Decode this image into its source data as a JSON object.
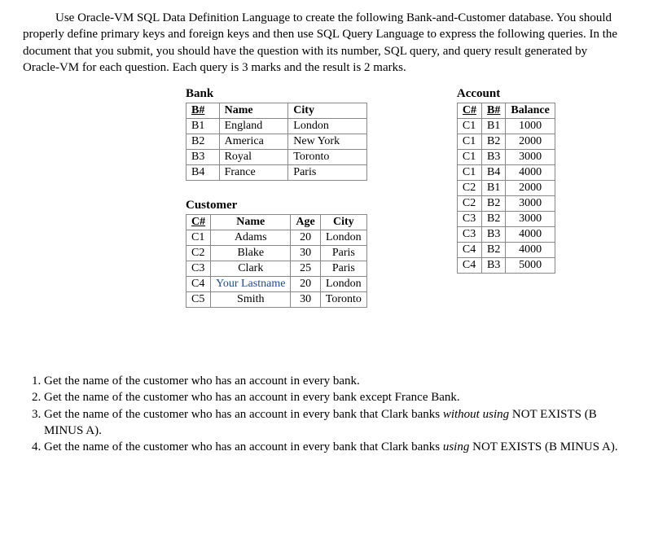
{
  "intro": {
    "text": "Use Oracle-VM SQL Data Definition Language to create the following Bank-and-Customer database. You should properly define primary keys and foreign keys and then use SQL Query Language to express the following queries. In the document that you submit, you should have the question with its number, SQL query, and query result generated by Oracle-VM for each question. Each query is 3 marks and the result is 2 marks."
  },
  "bank": {
    "title": "Bank",
    "headers": {
      "bnum": "B#",
      "name": "Name",
      "city": "City"
    },
    "rows": [
      {
        "bnum": "B1",
        "name": "England",
        "city": "London"
      },
      {
        "bnum": "B2",
        "name": "America",
        "city": "New York"
      },
      {
        "bnum": "B3",
        "name": "Royal",
        "city": "Toronto"
      },
      {
        "bnum": "B4",
        "name": "France",
        "city": "Paris"
      }
    ]
  },
  "customer": {
    "title": "Customer",
    "headers": {
      "cnum": "C#",
      "name": "Name",
      "age": "Age",
      "city": "City"
    },
    "rows": [
      {
        "cnum": "C1",
        "name": "Adams",
        "age": "20",
        "city": "London",
        "name_class": ""
      },
      {
        "cnum": "C2",
        "name": "Blake",
        "age": "30",
        "city": "Paris",
        "name_class": ""
      },
      {
        "cnum": "C3",
        "name": "Clark",
        "age": "25",
        "city": "Paris",
        "name_class": ""
      },
      {
        "cnum": "C4",
        "name": "Your Lastname",
        "age": "20",
        "city": "London",
        "name_class": "your-lastname"
      },
      {
        "cnum": "C5",
        "name": "Smith",
        "age": "30",
        "city": "Toronto",
        "name_class": ""
      }
    ]
  },
  "account": {
    "title": "Account",
    "headers": {
      "cnum": "C#",
      "bnum": "B#",
      "balance": "Balance"
    },
    "rows": [
      {
        "cnum": "C1",
        "bnum": "B1",
        "balance": "1000"
      },
      {
        "cnum": "C1",
        "bnum": "B2",
        "balance": "2000"
      },
      {
        "cnum": "C1",
        "bnum": "B3",
        "balance": "3000"
      },
      {
        "cnum": "C1",
        "bnum": "B4",
        "balance": "4000"
      },
      {
        "cnum": "C2",
        "bnum": "B1",
        "balance": "2000"
      },
      {
        "cnum": "C2",
        "bnum": "B2",
        "balance": "3000"
      },
      {
        "cnum": "C3",
        "bnum": "B2",
        "balance": "3000"
      },
      {
        "cnum": "C3",
        "bnum": "B3",
        "balance": "4000"
      },
      {
        "cnum": "C4",
        "bnum": "B2",
        "balance": "4000"
      },
      {
        "cnum": "C4",
        "bnum": "B3",
        "balance": "5000"
      }
    ]
  },
  "questions": {
    "q1": "Get the name of the customer who has an account in every bank.",
    "q2": "Get the name of the customer who has an account in every bank except France Bank.",
    "q3_a": "Get the name of the customer who has an account in every bank that Clark banks ",
    "q3_i": "without using",
    "q3_b": " NOT EXISTS (B MINUS A).",
    "q4_a": "Get the name of the customer who has an account in every bank that Clark banks ",
    "q4_i": "using",
    "q4_b": " NOT EXISTS (B MINUS A)."
  }
}
